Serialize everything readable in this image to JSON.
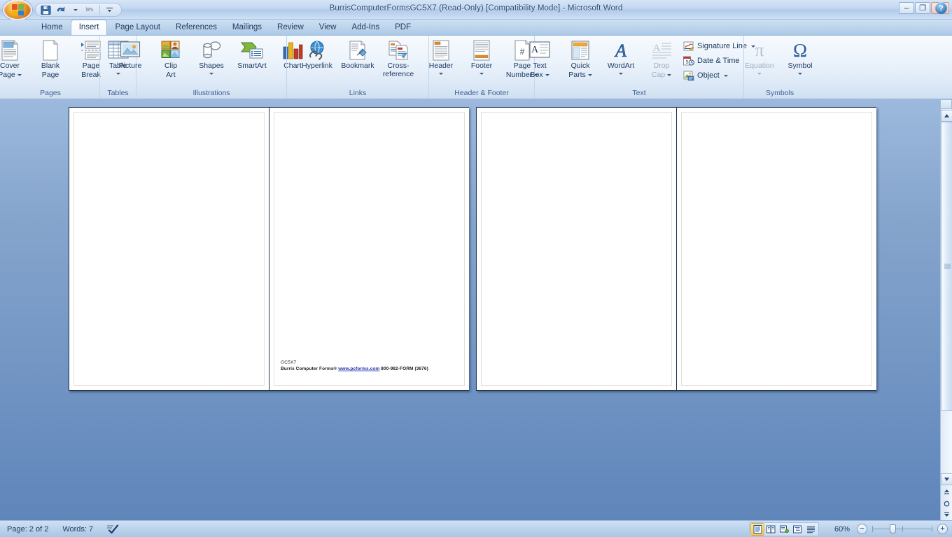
{
  "window": {
    "title": "BurrisComputerFormsGC5X7 (Read-Only) [Compatibility Mode] - Microsoft Word",
    "minimize_label": "–",
    "restore_label": "❐",
    "close_label": "✕",
    "help_label": "?"
  },
  "quick_access": {
    "save_title": "Save",
    "undo_title": "Undo",
    "redo_title": "Redo",
    "customize_title": "Customize Quick Access Toolbar"
  },
  "tabs": [
    {
      "label": "Home",
      "active": false
    },
    {
      "label": "Insert",
      "active": true
    },
    {
      "label": "Page Layout",
      "active": false
    },
    {
      "label": "References",
      "active": false
    },
    {
      "label": "Mailings",
      "active": false
    },
    {
      "label": "Review",
      "active": false
    },
    {
      "label": "View",
      "active": false
    },
    {
      "label": "Add-Ins",
      "active": false
    },
    {
      "label": "PDF",
      "active": false
    }
  ],
  "ribbon": {
    "groups": [
      {
        "name": "Pages",
        "label": "Pages",
        "buttons": [
          {
            "label": "Cover",
            "label2": "Page",
            "dropdown": "inline",
            "icon": "cover-page-icon",
            "disabled": false
          },
          {
            "label": "Blank",
            "label2": "Page",
            "dropdown": "none",
            "icon": "blank-page-icon",
            "disabled": false
          },
          {
            "label": "Page",
            "label2": "Break",
            "dropdown": "none",
            "icon": "page-break-icon",
            "disabled": false
          }
        ]
      },
      {
        "name": "Tables",
        "label": "Tables",
        "buttons": [
          {
            "label": "Table",
            "label2": "",
            "dropdown": "below",
            "icon": "table-icon",
            "disabled": false
          }
        ]
      },
      {
        "name": "Illustrations",
        "label": "Illustrations",
        "buttons": [
          {
            "label": "Picture",
            "label2": "",
            "dropdown": "none",
            "icon": "picture-icon",
            "disabled": false
          },
          {
            "label": "Clip",
            "label2": "Art",
            "dropdown": "none",
            "icon": "clip-art-icon",
            "disabled": false
          },
          {
            "label": "Shapes",
            "label2": "",
            "dropdown": "below",
            "icon": "shapes-icon",
            "disabled": false
          },
          {
            "label": "SmartArt",
            "label2": "",
            "dropdown": "none",
            "icon": "smartart-icon",
            "disabled": false
          },
          {
            "label": "Chart",
            "label2": "",
            "dropdown": "none",
            "icon": "chart-icon",
            "disabled": false
          }
        ]
      },
      {
        "name": "Links",
        "label": "Links",
        "buttons": [
          {
            "label": "Hyperlink",
            "label2": "",
            "dropdown": "none",
            "icon": "hyperlink-icon",
            "disabled": false
          },
          {
            "label": "Bookmark",
            "label2": "",
            "dropdown": "none",
            "icon": "bookmark-icon",
            "disabled": false
          },
          {
            "label": "Cross-reference",
            "label2": "",
            "dropdown": "none",
            "icon": "cross-reference-icon",
            "disabled": false
          }
        ]
      },
      {
        "name": "Header & Footer",
        "label": "Header & Footer",
        "buttons": [
          {
            "label": "Header",
            "label2": "",
            "dropdown": "below",
            "icon": "header-icon",
            "disabled": false
          },
          {
            "label": "Footer",
            "label2": "",
            "dropdown": "below",
            "icon": "footer-icon",
            "disabled": false
          },
          {
            "label": "Page",
            "label2": "Number",
            "dropdown": "inline",
            "icon": "page-number-icon",
            "disabled": false
          }
        ]
      },
      {
        "name": "Text",
        "label": "Text",
        "buttons": [
          {
            "label": "Text",
            "label2": "Box",
            "dropdown": "inline",
            "icon": "text-box-icon",
            "disabled": false
          },
          {
            "label": "Quick",
            "label2": "Parts",
            "dropdown": "inline",
            "icon": "quick-parts-icon",
            "disabled": false
          },
          {
            "label": "WordArt",
            "label2": "",
            "dropdown": "below",
            "icon": "wordart-icon",
            "disabled": false
          },
          {
            "label": "Drop",
            "label2": "Cap",
            "dropdown": "inline",
            "icon": "drop-cap-icon",
            "disabled": true
          }
        ],
        "small_buttons": [
          {
            "label": "Signature Line",
            "dropdown": true,
            "icon": "signature-line-icon"
          },
          {
            "label": "Date & Time",
            "dropdown": false,
            "icon": "date-time-icon"
          },
          {
            "label": "Object",
            "dropdown": true,
            "icon": "object-icon"
          }
        ]
      },
      {
        "name": "Symbols",
        "label": "Symbols",
        "buttons": [
          {
            "label": "Equation",
            "label2": "",
            "dropdown": "below",
            "icon": "equation-icon",
            "glyph": "π",
            "disabled": true
          },
          {
            "label": "Symbol",
            "label2": "",
            "dropdown": "below",
            "icon": "symbol-icon",
            "glyph": "Ω",
            "disabled": false
          }
        ]
      }
    ]
  },
  "document": {
    "line1": "GC5X7",
    "line2_prefix": "Burris Computer Forms® ",
    "line2_link": "www.pcforms.com",
    "line2_suffix": " 800-982-FORM (3676)"
  },
  "status": {
    "page": "Page: 2 of 2",
    "words": "Words: 7",
    "proofing_icon": "spell-check-icon",
    "zoom": "60%",
    "zoom_out": "−",
    "zoom_in": "+",
    "views": [
      {
        "name": "print-layout",
        "active": true
      },
      {
        "name": "full-screen-reading",
        "active": false
      },
      {
        "name": "web-layout",
        "active": false
      },
      {
        "name": "outline",
        "active": false
      },
      {
        "name": "draft",
        "active": false
      }
    ]
  },
  "scrollbar": {
    "previous_page": "▲",
    "select_browse_object": "●",
    "next_page": "▼"
  }
}
